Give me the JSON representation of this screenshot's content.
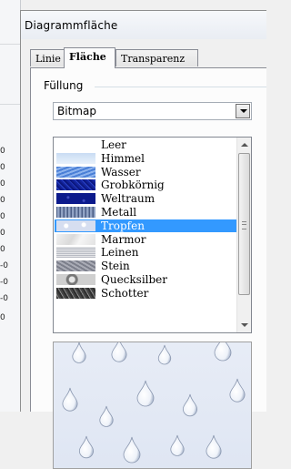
{
  "background_sheet": {
    "row_marks": [
      "0",
      "0",
      "0",
      "0",
      "0",
      "0",
      "0",
      "-0",
      "-0",
      "-0",
      "0"
    ]
  },
  "dialog": {
    "title": "Diagrammfläche",
    "tabs": [
      {
        "label": "Linie",
        "active": false
      },
      {
        "label": "Fläche",
        "active": true
      },
      {
        "label": "Transparenz",
        "active": false
      }
    ],
    "fill_group_label": "Füllung",
    "fill_type": {
      "value": "Bitmap"
    },
    "bitmap_list": [
      {
        "label": "Leer",
        "selected": false,
        "swatch": "none"
      },
      {
        "label": "Himmel",
        "selected": false,
        "swatch": "sky"
      },
      {
        "label": "Wasser",
        "selected": false,
        "swatch": "water"
      },
      {
        "label": "Grobkörnig",
        "selected": false,
        "swatch": "coarse"
      },
      {
        "label": "Weltraum",
        "selected": false,
        "swatch": "space"
      },
      {
        "label": "Metall",
        "selected": false,
        "swatch": "metal"
      },
      {
        "label": "Tropfen",
        "selected": true,
        "swatch": "drops"
      },
      {
        "label": "Marmor",
        "selected": false,
        "swatch": "marble"
      },
      {
        "label": "Leinen",
        "selected": false,
        "swatch": "linen"
      },
      {
        "label": "Stein",
        "selected": false,
        "swatch": "stone"
      },
      {
        "label": "Quecksilber",
        "selected": false,
        "swatch": "mercury"
      },
      {
        "label": "Schotter",
        "selected": false,
        "swatch": "gravel"
      }
    ],
    "preview_pattern": "drops"
  },
  "colors": {
    "selection": "#3399ff",
    "panel": "#fcfcfc"
  }
}
